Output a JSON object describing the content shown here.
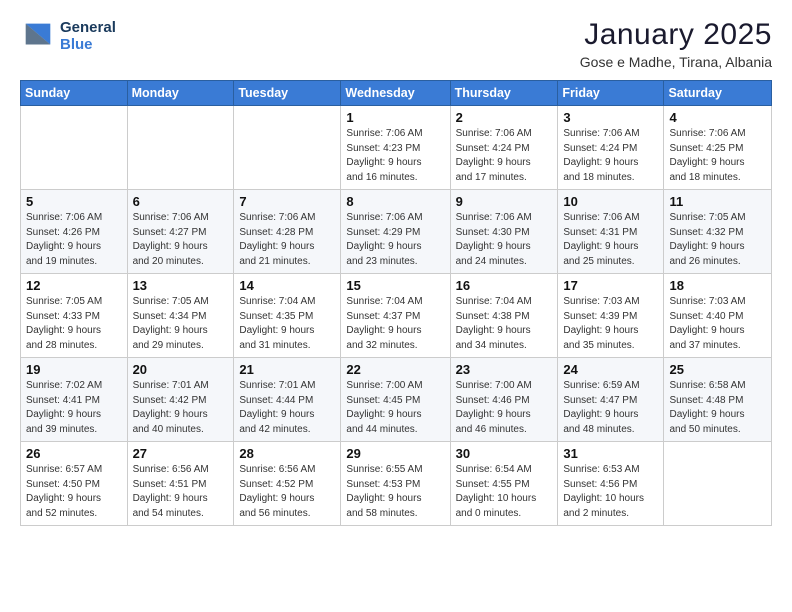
{
  "header": {
    "logo_general": "General",
    "logo_blue": "Blue",
    "title": "January 2025",
    "subtitle": "Gose e Madhe, Tirana, Albania"
  },
  "calendar": {
    "days_of_week": [
      "Sunday",
      "Monday",
      "Tuesday",
      "Wednesday",
      "Thursday",
      "Friday",
      "Saturday"
    ],
    "weeks": [
      [
        {
          "day": "",
          "info": ""
        },
        {
          "day": "",
          "info": ""
        },
        {
          "day": "",
          "info": ""
        },
        {
          "day": "1",
          "info": "Sunrise: 7:06 AM\nSunset: 4:23 PM\nDaylight: 9 hours\nand 16 minutes."
        },
        {
          "day": "2",
          "info": "Sunrise: 7:06 AM\nSunset: 4:24 PM\nDaylight: 9 hours\nand 17 minutes."
        },
        {
          "day": "3",
          "info": "Sunrise: 7:06 AM\nSunset: 4:24 PM\nDaylight: 9 hours\nand 18 minutes."
        },
        {
          "day": "4",
          "info": "Sunrise: 7:06 AM\nSunset: 4:25 PM\nDaylight: 9 hours\nand 18 minutes."
        }
      ],
      [
        {
          "day": "5",
          "info": "Sunrise: 7:06 AM\nSunset: 4:26 PM\nDaylight: 9 hours\nand 19 minutes."
        },
        {
          "day": "6",
          "info": "Sunrise: 7:06 AM\nSunset: 4:27 PM\nDaylight: 9 hours\nand 20 minutes."
        },
        {
          "day": "7",
          "info": "Sunrise: 7:06 AM\nSunset: 4:28 PM\nDaylight: 9 hours\nand 21 minutes."
        },
        {
          "day": "8",
          "info": "Sunrise: 7:06 AM\nSunset: 4:29 PM\nDaylight: 9 hours\nand 23 minutes."
        },
        {
          "day": "9",
          "info": "Sunrise: 7:06 AM\nSunset: 4:30 PM\nDaylight: 9 hours\nand 24 minutes."
        },
        {
          "day": "10",
          "info": "Sunrise: 7:06 AM\nSunset: 4:31 PM\nDaylight: 9 hours\nand 25 minutes."
        },
        {
          "day": "11",
          "info": "Sunrise: 7:05 AM\nSunset: 4:32 PM\nDaylight: 9 hours\nand 26 minutes."
        }
      ],
      [
        {
          "day": "12",
          "info": "Sunrise: 7:05 AM\nSunset: 4:33 PM\nDaylight: 9 hours\nand 28 minutes."
        },
        {
          "day": "13",
          "info": "Sunrise: 7:05 AM\nSunset: 4:34 PM\nDaylight: 9 hours\nand 29 minutes."
        },
        {
          "day": "14",
          "info": "Sunrise: 7:04 AM\nSunset: 4:35 PM\nDaylight: 9 hours\nand 31 minutes."
        },
        {
          "day": "15",
          "info": "Sunrise: 7:04 AM\nSunset: 4:37 PM\nDaylight: 9 hours\nand 32 minutes."
        },
        {
          "day": "16",
          "info": "Sunrise: 7:04 AM\nSunset: 4:38 PM\nDaylight: 9 hours\nand 34 minutes."
        },
        {
          "day": "17",
          "info": "Sunrise: 7:03 AM\nSunset: 4:39 PM\nDaylight: 9 hours\nand 35 minutes."
        },
        {
          "day": "18",
          "info": "Sunrise: 7:03 AM\nSunset: 4:40 PM\nDaylight: 9 hours\nand 37 minutes."
        }
      ],
      [
        {
          "day": "19",
          "info": "Sunrise: 7:02 AM\nSunset: 4:41 PM\nDaylight: 9 hours\nand 39 minutes."
        },
        {
          "day": "20",
          "info": "Sunrise: 7:01 AM\nSunset: 4:42 PM\nDaylight: 9 hours\nand 40 minutes."
        },
        {
          "day": "21",
          "info": "Sunrise: 7:01 AM\nSunset: 4:44 PM\nDaylight: 9 hours\nand 42 minutes."
        },
        {
          "day": "22",
          "info": "Sunrise: 7:00 AM\nSunset: 4:45 PM\nDaylight: 9 hours\nand 44 minutes."
        },
        {
          "day": "23",
          "info": "Sunrise: 7:00 AM\nSunset: 4:46 PM\nDaylight: 9 hours\nand 46 minutes."
        },
        {
          "day": "24",
          "info": "Sunrise: 6:59 AM\nSunset: 4:47 PM\nDaylight: 9 hours\nand 48 minutes."
        },
        {
          "day": "25",
          "info": "Sunrise: 6:58 AM\nSunset: 4:48 PM\nDaylight: 9 hours\nand 50 minutes."
        }
      ],
      [
        {
          "day": "26",
          "info": "Sunrise: 6:57 AM\nSunset: 4:50 PM\nDaylight: 9 hours\nand 52 minutes."
        },
        {
          "day": "27",
          "info": "Sunrise: 6:56 AM\nSunset: 4:51 PM\nDaylight: 9 hours\nand 54 minutes."
        },
        {
          "day": "28",
          "info": "Sunrise: 6:56 AM\nSunset: 4:52 PM\nDaylight: 9 hours\nand 56 minutes."
        },
        {
          "day": "29",
          "info": "Sunrise: 6:55 AM\nSunset: 4:53 PM\nDaylight: 9 hours\nand 58 minutes."
        },
        {
          "day": "30",
          "info": "Sunrise: 6:54 AM\nSunset: 4:55 PM\nDaylight: 10 hours\nand 0 minutes."
        },
        {
          "day": "31",
          "info": "Sunrise: 6:53 AM\nSunset: 4:56 PM\nDaylight: 10 hours\nand 2 minutes."
        },
        {
          "day": "",
          "info": ""
        }
      ]
    ]
  }
}
